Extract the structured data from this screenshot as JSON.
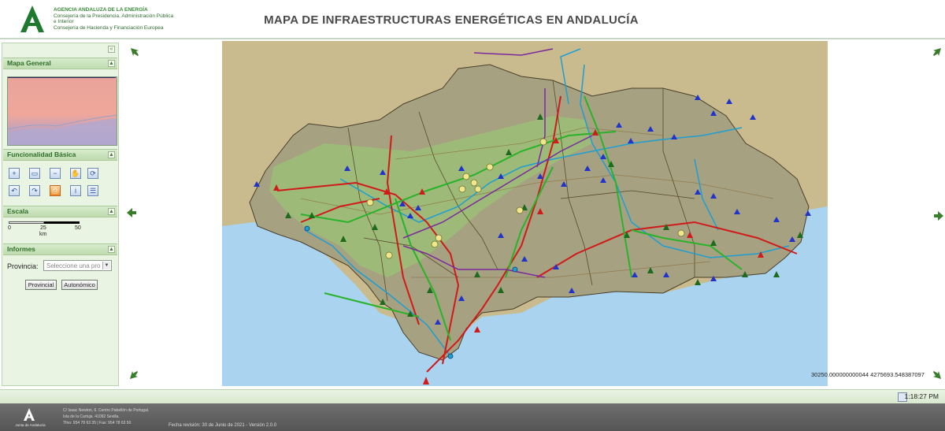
{
  "header": {
    "org_line1": "AGENCIA ANDALUZA DE LA ENERGÍA",
    "org_line2": "Consejería de la Presidencia, Administración Pública",
    "org_line3": "e Interior",
    "org_line4": "Consejería de Hacienda y Financiación Europea",
    "title": "MAPA DE INFRAESTRUCTURAS ENERGÉTICAS EN ANDALUCÍA"
  },
  "panel": {
    "collapse_icon": "«",
    "section_toggle_icon": "▲",
    "mapa_general": "Mapa General",
    "funcionalidad": "Funcionalidad Básica",
    "escala": "Escala",
    "scale_ticks": [
      "0",
      "25",
      "50"
    ],
    "scale_unit": "km",
    "informes": "Informes",
    "provincia_label": "Provincia:",
    "provincia_placeholder": "Seleccione una pro",
    "btn_provincial": "Provincial",
    "btn_autonomico": "Autonómico"
  },
  "tools": [
    {
      "name": "zoom-in-icon",
      "glyph": "+"
    },
    {
      "name": "zoom-extent-icon",
      "glyph": "▭"
    },
    {
      "name": "zoom-out-icon",
      "glyph": "−"
    },
    {
      "name": "pan-hand-icon",
      "glyph": "✋"
    },
    {
      "name": "refresh-icon",
      "glyph": "⟳"
    },
    {
      "name": "undo-icon",
      "glyph": "↶"
    },
    {
      "name": "redo-icon",
      "glyph": "↷"
    },
    {
      "name": "print-icon",
      "glyph": "⎙"
    },
    {
      "name": "info-icon",
      "glyph": "i"
    },
    {
      "name": "legend-icon",
      "glyph": "☰"
    }
  ],
  "map": {
    "coordinates": "30250.000000000044 4275693.548387097",
    "colors": {
      "sea": "#a9d3ef",
      "outside": "#c9bb8e",
      "region": "#a5a181",
      "valley": "#9cbc78",
      "gas_pipeline": "#1f9ed1",
      "power_line_400": "#d11a1a",
      "power_line_220": "#2ab22a",
      "oil_pipeline": "#7b2a9c",
      "substation": "#2233cc",
      "plant": "#1e6b1e",
      "solar": "#f0e68c"
    }
  },
  "status": {
    "clock": "1:18:27 PM"
  },
  "footer": {
    "org": "Junta de Andalucía",
    "address1": "C/ Isaac Newton, 6. Centro Pabellón de Portugal.",
    "address2": "Isla de la Cartuja. 41092 Sevilla.",
    "address3": "Tfno: 954 78 63 35 | Fax: 954 78 63 50",
    "revision": "Fecha revisión: 30 de Junio de 2021 - Versión 2.0.0"
  }
}
